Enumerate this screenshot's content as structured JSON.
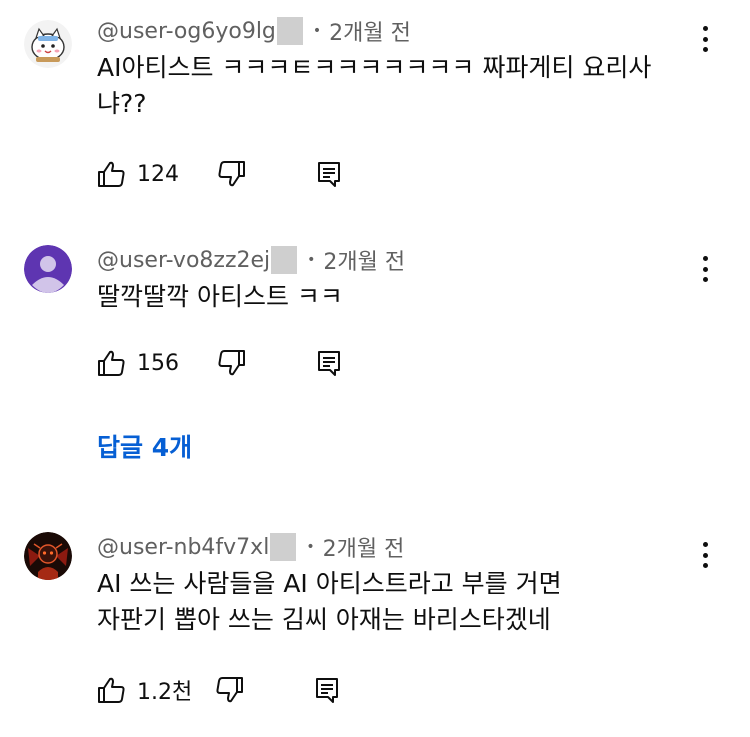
{
  "comments": [
    {
      "author": "@user-og6yo9lg",
      "time": "2개월 전",
      "lines": [
        "AI아티스트 ㅋㅋㅋㅌㅋㅋㅋㅋㅋㅋㅋ 짜파게티 요리사",
        "냐??"
      ],
      "likes": "124",
      "avatar_icon": "character-avatar-icon"
    },
    {
      "author": "@user-vo8zz2ej",
      "time": "2개월 전",
      "lines": [
        "딸깍딸깍 아티스트 ㅋㅋ"
      ],
      "likes": "156",
      "avatar_icon": "default-person-avatar-icon",
      "replies_label": "답글 4개"
    },
    {
      "author": "@user-nb4fv7xl",
      "time": "2개월 전",
      "lines": [
        "AI 쓰는 사람들을 AI 아티스트라고 부를 거면",
        "자판기 뽑아 쓰는 김씨 아재는 바리스타겠네"
      ],
      "likes": "1.2천",
      "avatar_icon": "dark-figure-avatar-icon"
    }
  ],
  "colors": {
    "text": "#0f0f0f",
    "meta": "#606060",
    "link": "#065fd4",
    "mask": "#cfcfcf",
    "avatar_purple": "#5e35b1"
  }
}
